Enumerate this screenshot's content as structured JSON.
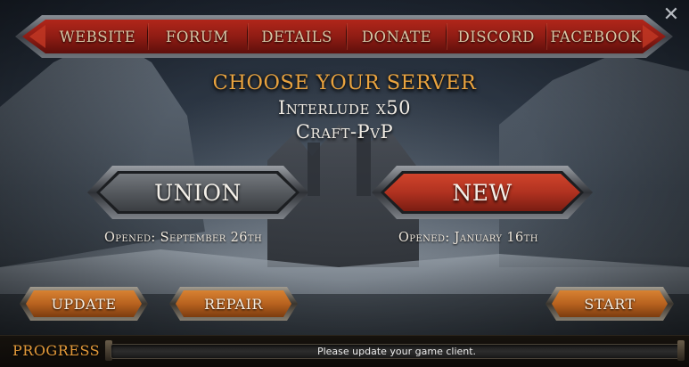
{
  "nav": {
    "items": [
      {
        "label": "WEBSITE"
      },
      {
        "label": "FORUM"
      },
      {
        "label": "DETAILS"
      },
      {
        "label": "DONATE"
      },
      {
        "label": "DISCORD"
      },
      {
        "label": "FACEBOOK"
      }
    ]
  },
  "window": {
    "close_icon": "close-icon"
  },
  "header": {
    "title": "CHOOSE YOUR SERVER",
    "line1": "Interlude x50",
    "line2": "Craft-PvP"
  },
  "servers": [
    {
      "label": "UNION",
      "opened": "Opened: September 26th",
      "color": "#5a5e63"
    },
    {
      "label": "NEW",
      "opened": "Opened: January 16th",
      "color": "#b03220"
    }
  ],
  "actions": {
    "update_label": "UPDATE",
    "repair_label": "REPAIR",
    "start_label": "START"
  },
  "progress": {
    "label": "PROGRESS",
    "value": 0,
    "status_text": "Please update your game client."
  },
  "colors": {
    "accent": "#e9a33f",
    "nav_red": "#8f1c14",
    "button_orange": "#b8621f",
    "text_light": "#f1ece4"
  }
}
